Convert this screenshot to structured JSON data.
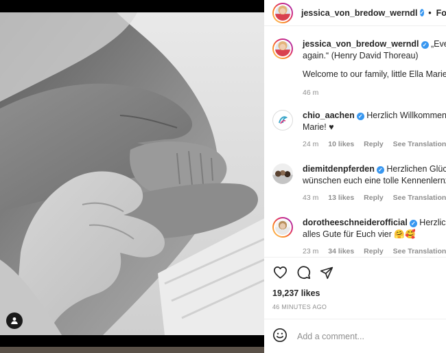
{
  "post": {
    "username": "jessica_von_bredow_werndl",
    "follow_label": "Follow",
    "separator": "•"
  },
  "caption": {
    "username": "jessica_von_bredow_werndl",
    "line1": "„Every",
    "line2": "again.“ (Henry David Thoreau)",
    "line3": "Welcome to our family, little Ella Marie.",
    "time": "46 m"
  },
  "comments": [
    {
      "username": "chio_aachen",
      "text1": "Herzlich Willkommen a",
      "text2": "Marie! ♥",
      "time": "24 m",
      "likes": "10 likes",
      "reply": "Reply",
      "translate": "See Translation"
    },
    {
      "username": "diemitdenpferden",
      "text1": "Herzlichen Glück",
      "text2": "wünschen euch eine tolle Kennenlernze",
      "time": "43 m",
      "likes": "13 likes",
      "reply": "Reply",
      "translate": "See Translation"
    },
    {
      "username": "dorotheeschneiderofficial",
      "text1": "Herzliche",
      "text2": "alles Gute für Euch vier 🤗🥰",
      "time": "23 m",
      "likes": "34 likes",
      "reply": "Reply",
      "translate": "See Translation"
    }
  ],
  "stats": {
    "likes": "19,237 likes",
    "time_ago": "46 MINUTES AGO"
  },
  "add_comment": {
    "placeholder": "Add a comment..."
  },
  "icons": {
    "like": "heart-icon",
    "comment": "comment-icon",
    "share": "send-icon",
    "emoji": "smiley-icon",
    "tag": "user-tag-icon"
  },
  "colors": {
    "verified": "#3897f0",
    "muted": "#8e8e8e",
    "text": "#262626"
  }
}
